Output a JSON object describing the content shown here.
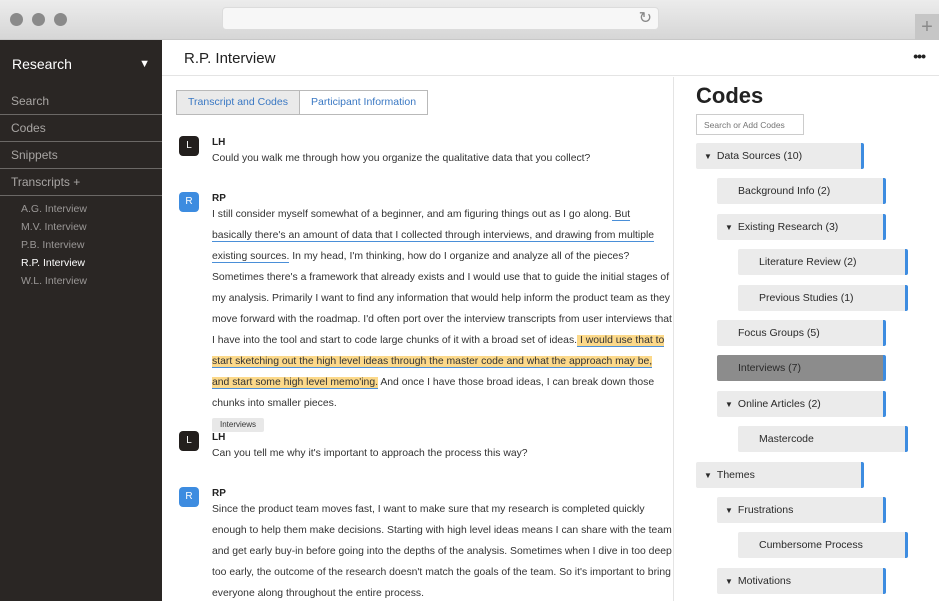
{
  "browser": {
    "reload_icon": "↻",
    "new_tab_icon": "+"
  },
  "sidebar": {
    "workspace": "Research",
    "workspace_chevron": "⌄",
    "nav": [
      {
        "label": "Search"
      },
      {
        "label": "Codes"
      },
      {
        "label": "Snippets"
      },
      {
        "label": "Transcripts +"
      }
    ],
    "transcripts": [
      {
        "label": "A.G. Interview",
        "active": false
      },
      {
        "label": "M.V. Interview",
        "active": false
      },
      {
        "label": "P.B. Interview",
        "active": false
      },
      {
        "label": "R.P. Interview",
        "active": true
      },
      {
        "label": "W.L. Interview",
        "active": false
      }
    ]
  },
  "header": {
    "title": "R.P. Interview",
    "more_icon": "•••"
  },
  "tabs": [
    {
      "label": "Transcript and Codes",
      "active": true
    },
    {
      "label": "Participant Information",
      "active": false
    }
  ],
  "transcript": [
    {
      "initial": "L",
      "speaker": "LH",
      "text": "Could you walk me through how you organize the qualitative data that you collect?"
    },
    {
      "initial": "R",
      "speaker": "RP",
      "segments": [
        {
          "text": "I still consider myself somewhat of a beginner, and am figuring things out as I go along.",
          "style": "plain"
        },
        {
          "text": " But basically there's an amount of data that I collected through interviews, and drawing from multiple existing sources.",
          "style": "underline"
        },
        {
          "text": " In my head, I'm thinking, how do I organize and analyze all of the pieces? Sometimes there's a framework that already exists and I would use that to guide the initial stages of my analysis. Primarily I want to find any information that would help inform the product team as they move forward with the roadmap. I'd often port over the interview transcripts from user interviews that I have into the tool and start to code large chunks of it with a broad set of ideas.",
          "style": "plain"
        },
        {
          "text": " I would use that to start sketching out the high level ideas through the master code and what the approach may be, and start some high level memo'ing.",
          "style": "highlight"
        },
        {
          "text": " And once I have those broad ideas, I can break down those chunks into smaller pieces.",
          "style": "plain"
        }
      ],
      "tag": "Interviews"
    },
    {
      "initial": "L",
      "speaker": "LH",
      "text": "Can you tell me why it's important to approach the process this way?"
    },
    {
      "initial": "R",
      "speaker": "RP",
      "text": "Since the product team moves fast, I want to make sure that my research is completed quickly enough to help them make decisions. Starting with high level ideas means I can share with the team and get early buy-in before going into the depths of the analysis. Sometimes when I dive in too deep too early, the outcome of the research doesn't match the goals of the team. So it's important to bring everyone along throughout the entire process."
    }
  ],
  "codes": {
    "title": "Codes",
    "search_placeholder": "Search or Add Codes",
    "tree": [
      {
        "label": "Data Sources (10)",
        "level": 0,
        "expanded": true,
        "selected": false
      },
      {
        "label": "Background Info (2)",
        "level": 1,
        "expanded": null,
        "selected": false
      },
      {
        "label": "Existing Research (3)",
        "level": 1,
        "expanded": true,
        "selected": false
      },
      {
        "label": "Literature Review (2)",
        "level": 2,
        "expanded": null,
        "selected": false
      },
      {
        "label": "Previous Studies (1)",
        "level": 2,
        "expanded": null,
        "selected": false
      },
      {
        "label": "Focus Groups (5)",
        "level": 1,
        "expanded": null,
        "selected": false
      },
      {
        "label": "Interviews (7)",
        "level": 1,
        "expanded": null,
        "selected": true
      },
      {
        "label": "Online Articles (2)",
        "level": 1,
        "expanded": true,
        "selected": false
      },
      {
        "label": "Mastercode",
        "level": 2,
        "expanded": null,
        "selected": false
      },
      {
        "label": "Themes",
        "level": 0,
        "expanded": true,
        "selected": false
      },
      {
        "label": "Frustrations",
        "level": 1,
        "expanded": true,
        "selected": false
      },
      {
        "label": "Cumbersome Process",
        "level": 2,
        "expanded": null,
        "selected": false
      },
      {
        "label": "Motivations",
        "level": 1,
        "expanded": true,
        "selected": false
      }
    ],
    "accent_color": "#3d8ce0",
    "selected_color": "#8c8c8c"
  },
  "colors": {
    "sidebar_bg": "#2a2624",
    "highlight": "#fcd98a",
    "underline": "#4a8fd8",
    "avatar_lh": "#231f1d",
    "avatar_rp": "#3d8ce0",
    "tab_text": "#3a78c3"
  }
}
